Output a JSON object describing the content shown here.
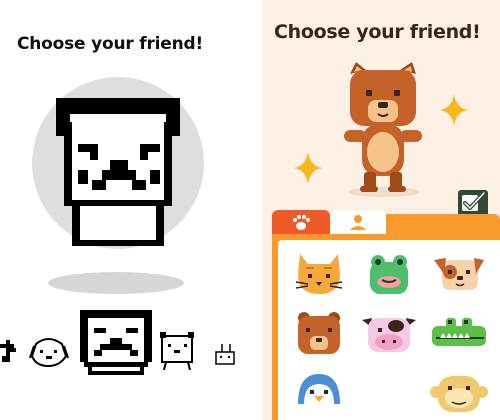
{
  "left_panel": {
    "title": "Choose your friend!",
    "carousel": [
      "cat-icon",
      "dog-icon",
      "pug-icon",
      "bear-icon",
      "bunny-icon"
    ],
    "selected": "pug-icon"
  },
  "right_panel": {
    "title": "Choose your friend!",
    "hero": "bear-icon",
    "tabs": [
      "paw-icon",
      "person-icon"
    ],
    "active_tab": "paw-icon",
    "grid": [
      [
        "cat-icon",
        "frog-icon",
        "dog-icon"
      ],
      [
        "bear-icon",
        "cow-icon",
        "crocodile-icon"
      ],
      [
        "penguin-icon",
        "",
        "monkey-icon"
      ]
    ],
    "colors": {
      "accent": "#f99a2a",
      "tab_active": "#f05a28",
      "confirm": "#2f4a34",
      "background": "#fdf1e6",
      "title": "#3c2418"
    }
  }
}
